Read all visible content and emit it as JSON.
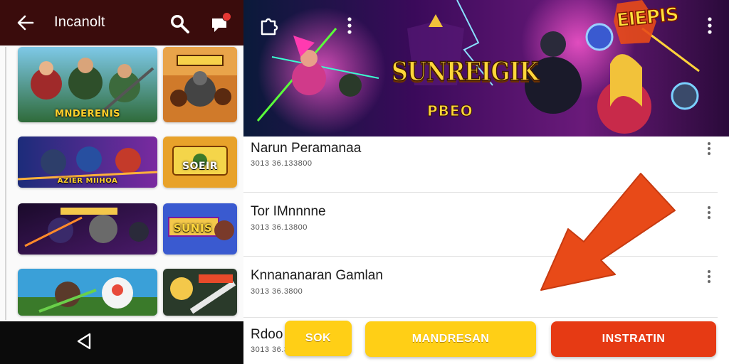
{
  "left_pane": {
    "app_title": "Incanolt",
    "icons": {
      "back": "arrow-left-icon",
      "search": "search-icon",
      "chat": "chat-icon",
      "nav_back": "triangle-back-icon"
    },
    "tiles": [
      {
        "caption": "MNDERENIS"
      },
      {
        "caption": ""
      },
      {
        "caption": "AZIER MIIHOA"
      },
      {
        "caption": "SOEIR"
      },
      {
        "caption": ""
      },
      {
        "caption": "SUNIS"
      },
      {
        "caption": ""
      },
      {
        "caption": ""
      }
    ]
  },
  "banner": {
    "title": "SUNREIGIK",
    "subtitle": "PBEO",
    "badge": "EIEPIS",
    "icons": {
      "brand": "puzzle-icon",
      "menu": "more-vertical-icon"
    }
  },
  "list": [
    {
      "title": "Narun Peramanaa",
      "meta": "3013 36.133800"
    },
    {
      "title": "Tor IMnnnne",
      "meta": "3013 36.13800"
    },
    {
      "title": "Knnananaran Gamlan",
      "meta": "3013 36.3800"
    },
    {
      "title": "Rdoo",
      "meta": "3013 36.3800"
    }
  ],
  "actions": {
    "sok": "SOK",
    "mandresan": "MANDRESAN",
    "instratin": "INSTRATIN"
  },
  "colors": {
    "topbar": "#3a0c0c",
    "accent_yellow": "#ffcf16",
    "accent_red": "#e63a14",
    "arrow": "#e84a18"
  }
}
